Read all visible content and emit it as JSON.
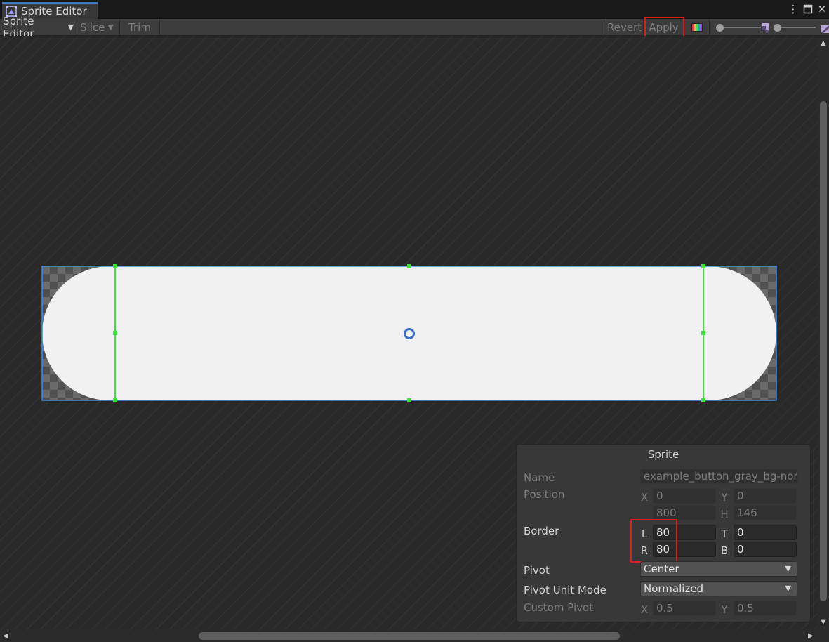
{
  "tab": {
    "title": "Sprite Editor",
    "icon": "sprite-editor-icon"
  },
  "window_controls": {
    "menu": "⋮",
    "maximize": "□",
    "close": "✕"
  },
  "toolbar": {
    "mode_label": "Sprite Editor",
    "slice_label": "Slice",
    "trim_label": "Trim",
    "revert_label": "Revert",
    "apply_label": "Apply",
    "color_toggle_icon": "rgb-channels-icon"
  },
  "sprite_panel": {
    "title": "Sprite",
    "name_label": "Name",
    "name_value": "example_button_gray_bg-normal",
    "position_label": "Position",
    "x_label": "X",
    "x_value": "0",
    "y_label": "Y",
    "y_value": "0",
    "w_value": "800",
    "h_label": "H",
    "h_value": "146",
    "border_label": "Border",
    "l_label": "L",
    "l_value": "80",
    "t_label": "T",
    "t_value": "0",
    "r_label": "R",
    "r_value": "80",
    "b_label": "B",
    "b_value": "0",
    "pivot_label": "Pivot",
    "pivot_value": "Center",
    "pivot_unit_mode_label": "Pivot Unit Mode",
    "pivot_unit_mode_value": "Normalized",
    "custom_pivot_label": "Custom Pivot",
    "custom_x_label": "X",
    "custom_x_value": "0.5",
    "custom_y_label": "Y",
    "custom_y_value": "0.5"
  },
  "colors": {
    "highlight": "#e01b1b",
    "border_lines": "#3ce23c",
    "selection_outline": "#3a8ee6",
    "sprite_fill": "#f1f1f1"
  }
}
